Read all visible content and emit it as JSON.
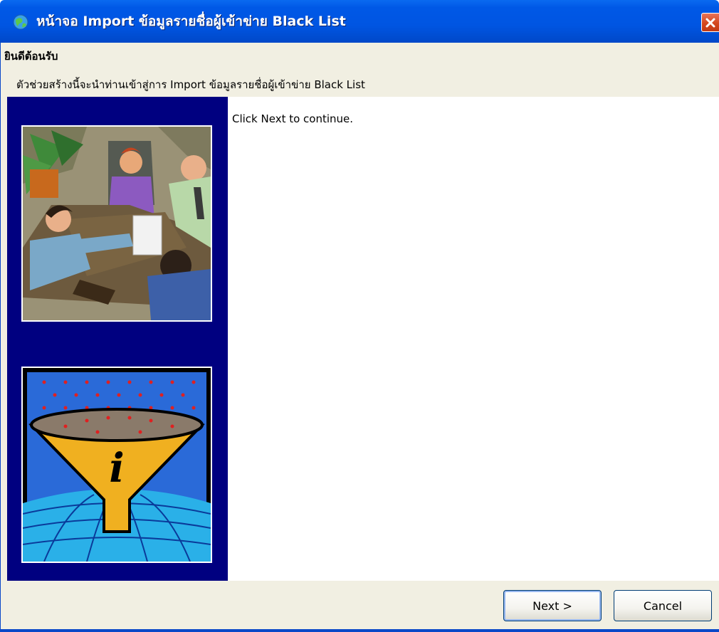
{
  "window": {
    "title": "หน้าจอ Import ข้อมูลรายชื่อผู้เข้าข่าย Black List",
    "title_icon": "globe-icon",
    "close_icon": "close-icon"
  },
  "header": {
    "title": "ยินดีต้อนรับ",
    "subtitle": "ตัวช่วยสร้างนี้จะนำท่านเข้าสู่การ Import ข้อมูลรายชื่อผู้เข้าข่าย Black List"
  },
  "sidebar": {
    "images": [
      "meeting-clipart",
      "info-funnel-clipart"
    ]
  },
  "content": {
    "message": "Click Next to continue."
  },
  "buttons": {
    "next": "Next >",
    "cancel": "Cancel"
  },
  "colors": {
    "titlebar": "#0055e2",
    "sidebar": "#000080",
    "panel": "#f1efe2",
    "close": "#d4471f"
  }
}
